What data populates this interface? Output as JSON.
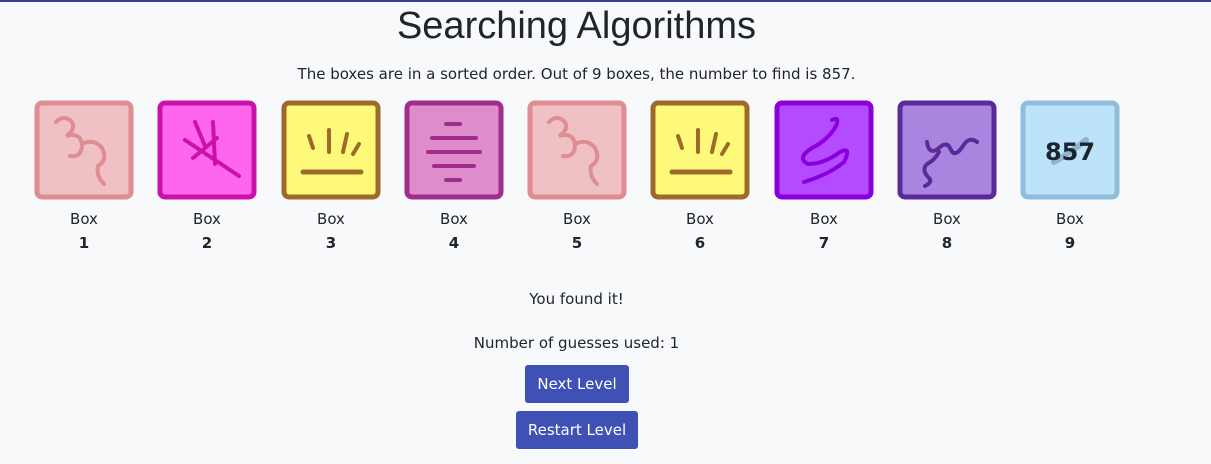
{
  "page": {
    "title": "Searching Algorithms",
    "instructions": "The boxes are in a sorted order. Out of 9 boxes, the number to find is 857."
  },
  "boxes": [
    {
      "label": "Box",
      "number": "1",
      "fill": "#efc1c4",
      "stroke": "#e08c93",
      "symbol": "squiggle-3-glyph",
      "revealed_value": ""
    },
    {
      "label": "Box",
      "number": "2",
      "fill": "#ff66ee",
      "stroke": "#cc11aa",
      "symbol": "crossed-lines-glyph",
      "revealed_value": ""
    },
    {
      "label": "Box",
      "number": "3",
      "fill": "#fff97a",
      "stroke": "#9c6a2a",
      "symbol": "sunrise-glyph",
      "revealed_value": ""
    },
    {
      "label": "Box",
      "number": "4",
      "fill": "#df8ccd",
      "stroke": "#a02c8e",
      "symbol": "stacked-bars-glyph",
      "revealed_value": ""
    },
    {
      "label": "Box",
      "number": "5",
      "fill": "#efc1c4",
      "stroke": "#e08c93",
      "symbol": "squiggle-3-glyph",
      "revealed_value": ""
    },
    {
      "label": "Box",
      "number": "6",
      "fill": "#fff97a",
      "stroke": "#9c6a2a",
      "symbol": "sunrise-glyph",
      "revealed_value": ""
    },
    {
      "label": "Box",
      "number": "7",
      "fill": "#b54bff",
      "stroke": "#8a00dd",
      "symbol": "s-curve-glyph",
      "revealed_value": ""
    },
    {
      "label": "Box",
      "number": "8",
      "fill": "#a985df",
      "stroke": "#5a2a9a",
      "symbol": "wave-glyph",
      "revealed_value": ""
    },
    {
      "label": "Box",
      "number": "9",
      "fill": "#bde3fb",
      "stroke": "#8fbddb",
      "symbol": "revealed-number",
      "revealed_value": "857"
    }
  ],
  "result": {
    "status": "You found it!",
    "guesses": "Number of guesses used: 1"
  },
  "buttons": {
    "next_label": "Next Level",
    "restart_label": "Restart Level",
    "color": "#3f51b5"
  }
}
